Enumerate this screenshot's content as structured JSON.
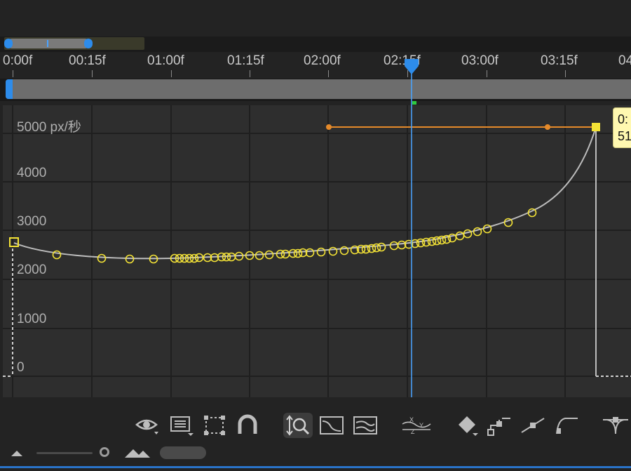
{
  "ruler": {
    "ticks": [
      "0:00f",
      "00:15f",
      "01:00f",
      "01:15f",
      "02:00f",
      "02:15f",
      "03:00f",
      "03:15f",
      "04"
    ]
  },
  "graph": {
    "y_axis_labels": [
      "5000 px/秒",
      "4000",
      "3000",
      "2000",
      "1000",
      "0"
    ]
  },
  "tooltip": {
    "line1": "0:",
    "line2": "51"
  },
  "toolbar": {
    "icons": [
      "eye-icon",
      "list-icon",
      "transform-box-icon",
      "snap-magnet-icon",
      "auto-zoom-height-icon",
      "fit-selection-icon",
      "fit-all-icon",
      "separate-dimensions-icon",
      "keyframe-diamond-icon",
      "hold-keyframe-icon",
      "linear-keyframe-icon",
      "auto-bezier-icon",
      "easy-ease-icon"
    ]
  },
  "colors": {
    "keyframe": "#f3e236",
    "curve": "#bdbdbd",
    "playhead": "#4aa3ff",
    "handle": "#e58a2a",
    "accent": "#2d8ceb"
  }
}
